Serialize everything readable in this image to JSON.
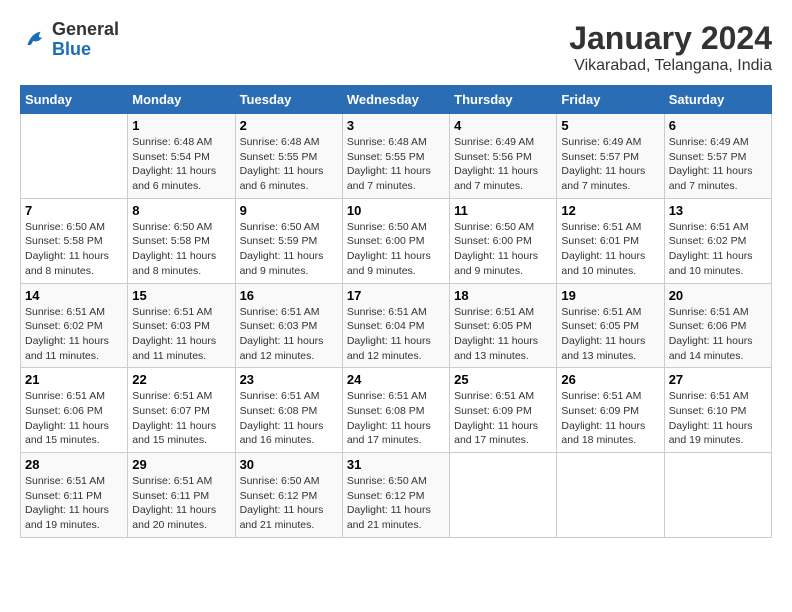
{
  "header": {
    "logo": {
      "general": "General",
      "blue": "Blue"
    },
    "title": "January 2024",
    "location": "Vikarabad, Telangana, India"
  },
  "weekdays": [
    "Sunday",
    "Monday",
    "Tuesday",
    "Wednesday",
    "Thursday",
    "Friday",
    "Saturday"
  ],
  "weeks": [
    [
      null,
      {
        "day": 1,
        "sunrise": "6:48 AM",
        "sunset": "5:54 PM",
        "daylight": "11 hours and 6 minutes."
      },
      {
        "day": 2,
        "sunrise": "6:48 AM",
        "sunset": "5:55 PM",
        "daylight": "11 hours and 6 minutes."
      },
      {
        "day": 3,
        "sunrise": "6:48 AM",
        "sunset": "5:55 PM",
        "daylight": "11 hours and 7 minutes."
      },
      {
        "day": 4,
        "sunrise": "6:49 AM",
        "sunset": "5:56 PM",
        "daylight": "11 hours and 7 minutes."
      },
      {
        "day": 5,
        "sunrise": "6:49 AM",
        "sunset": "5:57 PM",
        "daylight": "11 hours and 7 minutes."
      },
      {
        "day": 6,
        "sunrise": "6:49 AM",
        "sunset": "5:57 PM",
        "daylight": "11 hours and 7 minutes."
      }
    ],
    [
      {
        "day": 7,
        "sunrise": "6:50 AM",
        "sunset": "5:58 PM",
        "daylight": "11 hours and 8 minutes."
      },
      {
        "day": 8,
        "sunrise": "6:50 AM",
        "sunset": "5:58 PM",
        "daylight": "11 hours and 8 minutes."
      },
      {
        "day": 9,
        "sunrise": "6:50 AM",
        "sunset": "5:59 PM",
        "daylight": "11 hours and 9 minutes."
      },
      {
        "day": 10,
        "sunrise": "6:50 AM",
        "sunset": "6:00 PM",
        "daylight": "11 hours and 9 minutes."
      },
      {
        "day": 11,
        "sunrise": "6:50 AM",
        "sunset": "6:00 PM",
        "daylight": "11 hours and 9 minutes."
      },
      {
        "day": 12,
        "sunrise": "6:51 AM",
        "sunset": "6:01 PM",
        "daylight": "11 hours and 10 minutes."
      },
      {
        "day": 13,
        "sunrise": "6:51 AM",
        "sunset": "6:02 PM",
        "daylight": "11 hours and 10 minutes."
      }
    ],
    [
      {
        "day": 14,
        "sunrise": "6:51 AM",
        "sunset": "6:02 PM",
        "daylight": "11 hours and 11 minutes."
      },
      {
        "day": 15,
        "sunrise": "6:51 AM",
        "sunset": "6:03 PM",
        "daylight": "11 hours and 11 minutes."
      },
      {
        "day": 16,
        "sunrise": "6:51 AM",
        "sunset": "6:03 PM",
        "daylight": "11 hours and 12 minutes."
      },
      {
        "day": 17,
        "sunrise": "6:51 AM",
        "sunset": "6:04 PM",
        "daylight": "11 hours and 12 minutes."
      },
      {
        "day": 18,
        "sunrise": "6:51 AM",
        "sunset": "6:05 PM",
        "daylight": "11 hours and 13 minutes."
      },
      {
        "day": 19,
        "sunrise": "6:51 AM",
        "sunset": "6:05 PM",
        "daylight": "11 hours and 13 minutes."
      },
      {
        "day": 20,
        "sunrise": "6:51 AM",
        "sunset": "6:06 PM",
        "daylight": "11 hours and 14 minutes."
      }
    ],
    [
      {
        "day": 21,
        "sunrise": "6:51 AM",
        "sunset": "6:06 PM",
        "daylight": "11 hours and 15 minutes."
      },
      {
        "day": 22,
        "sunrise": "6:51 AM",
        "sunset": "6:07 PM",
        "daylight": "11 hours and 15 minutes."
      },
      {
        "day": 23,
        "sunrise": "6:51 AM",
        "sunset": "6:08 PM",
        "daylight": "11 hours and 16 minutes."
      },
      {
        "day": 24,
        "sunrise": "6:51 AM",
        "sunset": "6:08 PM",
        "daylight": "11 hours and 17 minutes."
      },
      {
        "day": 25,
        "sunrise": "6:51 AM",
        "sunset": "6:09 PM",
        "daylight": "11 hours and 17 minutes."
      },
      {
        "day": 26,
        "sunrise": "6:51 AM",
        "sunset": "6:09 PM",
        "daylight": "11 hours and 18 minutes."
      },
      {
        "day": 27,
        "sunrise": "6:51 AM",
        "sunset": "6:10 PM",
        "daylight": "11 hours and 19 minutes."
      }
    ],
    [
      {
        "day": 28,
        "sunrise": "6:51 AM",
        "sunset": "6:11 PM",
        "daylight": "11 hours and 19 minutes."
      },
      {
        "day": 29,
        "sunrise": "6:51 AM",
        "sunset": "6:11 PM",
        "daylight": "11 hours and 20 minutes."
      },
      {
        "day": 30,
        "sunrise": "6:50 AM",
        "sunset": "6:12 PM",
        "daylight": "11 hours and 21 minutes."
      },
      {
        "day": 31,
        "sunrise": "6:50 AM",
        "sunset": "6:12 PM",
        "daylight": "11 hours and 21 minutes."
      },
      null,
      null,
      null
    ]
  ],
  "labels": {
    "sunrise": "Sunrise:",
    "sunset": "Sunset:",
    "daylight": "Daylight:"
  }
}
